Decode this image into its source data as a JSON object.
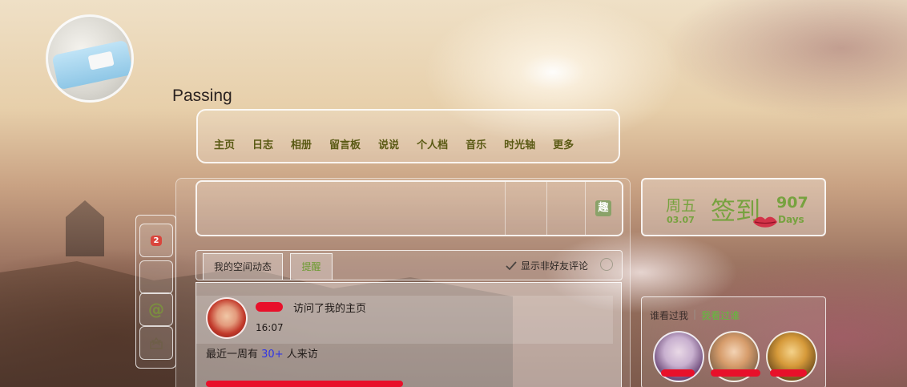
{
  "profile": {
    "site_name": "Passing"
  },
  "nav": {
    "items": [
      "主页",
      "日志",
      "相册",
      "留言板",
      "说说",
      "个人档",
      "音乐",
      "时光轴",
      "更多"
    ]
  },
  "side_tools": {
    "notification_count": "2",
    "at_symbol": "@"
  },
  "post_box": {
    "fun_label": "趣"
  },
  "feed_tabs": {
    "my_space": "我的空间动态",
    "other": "提醒",
    "show_non_friend": "显示非好友评论"
  },
  "feed": {
    "item": {
      "action": "访问了我的主页",
      "time": "16:07"
    },
    "visits_prefix": "最近一周有",
    "visits_count": "30+",
    "visits_suffix": "人来访"
  },
  "checkin": {
    "weekday": "周五",
    "date": "03.07",
    "label": "签到",
    "count": "907",
    "unit": "Days"
  },
  "visitors": {
    "tab_visited_me": "谁看过我",
    "tab_i_visited": "我看过谁"
  },
  "colors": {
    "accent_green": "#77a23f",
    "badge_red": "#d9453c",
    "link_blue": "#2f35e6",
    "nav_text": "#5a5a14"
  }
}
